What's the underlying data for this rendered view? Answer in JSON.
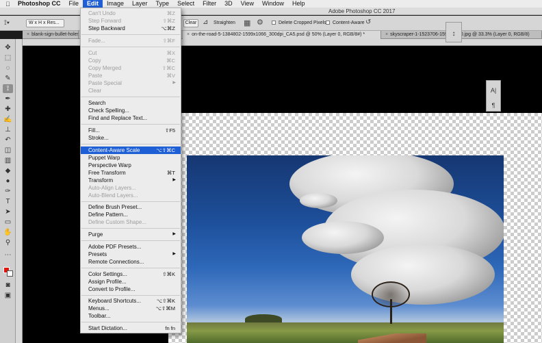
{
  "menubar": {
    "apple_icon": "apple-icon",
    "items": [
      "Photoshop CC",
      "File",
      "Edit",
      "Image",
      "Layer",
      "Type",
      "Select",
      "Filter",
      "3D",
      "View",
      "Window",
      "Help"
    ],
    "active": "Edit"
  },
  "titlebar": {
    "title": "Adobe Photoshop CC 2017"
  },
  "options_bar": {
    "ratio": "W x H x Res...",
    "clear": "Clear",
    "straighten": "Straighten",
    "delete_cropped": "Delete Cropped Pixels",
    "content_aware": "Content-Aware"
  },
  "tabs": [
    {
      "label": "blank-sign-bullet-holes",
      "close": "×"
    },
    {
      "label": "on-the-road-5-1384802-1599x1066_300dpi_CA5.psd @ 50% (Layer 0, RGB/8#) *",
      "close": "×"
    },
    {
      "label": "skyscraper-1-1523706-1599x1200.jpg @ 33.3% (Layer 0, RGB/8)",
      "close": "×"
    }
  ],
  "tools": [
    "move-icon",
    "marquee-icon",
    "lasso-icon",
    "quick-select-icon",
    "crop-icon",
    "eyedropper-icon",
    "healing-icon",
    "brush-icon",
    "stamp-icon",
    "history-brush-icon",
    "eraser-icon",
    "gradient-icon",
    "blur-icon",
    "dodge-icon",
    "pen-icon",
    "type-icon",
    "path-select-icon",
    "shape-icon",
    "hand-icon",
    "zoom-icon",
    "more-icon"
  ],
  "colors": {
    "foreground": "#e0160f",
    "background": "#ffffff",
    "highlight": "#1f5fd6"
  },
  "edit_menu": [
    {
      "label": "Can't Undo",
      "shortcut": "⌘Z",
      "disabled": true
    },
    {
      "label": "Step Forward",
      "shortcut": "⇧⌘Z",
      "disabled": true
    },
    {
      "label": "Step Backward",
      "shortcut": "⌥⌘Z",
      "disabled": false
    },
    {
      "label": "Fade...",
      "shortcut": "⇧⌘F",
      "disabled": true
    },
    {
      "label": "Cut",
      "shortcut": "⌘X",
      "disabled": true
    },
    {
      "label": "Copy",
      "shortcut": "⌘C",
      "disabled": true
    },
    {
      "label": "Copy Merged",
      "shortcut": "⇧⌘C",
      "disabled": true
    },
    {
      "label": "Paste",
      "shortcut": "⌘V",
      "disabled": true
    },
    {
      "label": "Paste Special",
      "shortcut": "",
      "disabled": true,
      "submenu": true
    },
    {
      "label": "Clear",
      "shortcut": "",
      "disabled": true
    },
    {
      "label": "Search",
      "shortcut": "",
      "disabled": false
    },
    {
      "label": "Check Spelling...",
      "shortcut": "",
      "disabled": false
    },
    {
      "label": "Find and Replace Text...",
      "shortcut": "",
      "disabled": false
    },
    {
      "label": "Fill...",
      "shortcut": "⇧F5",
      "disabled": false
    },
    {
      "label": "Stroke...",
      "shortcut": "",
      "disabled": false
    },
    {
      "label": "Content-Aware Scale",
      "shortcut": "⌥⇧⌘C",
      "disabled": false,
      "highlighted": true
    },
    {
      "label": "Puppet Warp",
      "shortcut": "",
      "disabled": false
    },
    {
      "label": "Perspective Warp",
      "shortcut": "",
      "disabled": false
    },
    {
      "label": "Free Transform",
      "shortcut": "⌘T",
      "disabled": false
    },
    {
      "label": "Transform",
      "shortcut": "",
      "disabled": false,
      "submenu": true
    },
    {
      "label": "Auto-Align Layers...",
      "shortcut": "",
      "disabled": true
    },
    {
      "label": "Auto-Blend Layers...",
      "shortcut": "",
      "disabled": true
    },
    {
      "label": "Define Brush Preset...",
      "shortcut": "",
      "disabled": false
    },
    {
      "label": "Define Pattern...",
      "shortcut": "",
      "disabled": false
    },
    {
      "label": "Define Custom Shape...",
      "shortcut": "",
      "disabled": true
    },
    {
      "label": "Purge",
      "shortcut": "",
      "disabled": false,
      "submenu": true
    },
    {
      "label": "Adobe PDF Presets...",
      "shortcut": "",
      "disabled": false
    },
    {
      "label": "Presets",
      "shortcut": "",
      "disabled": false,
      "submenu": true
    },
    {
      "label": "Remote Connections...",
      "shortcut": "",
      "disabled": false
    },
    {
      "label": "Color Settings...",
      "shortcut": "⇧⌘K",
      "disabled": false
    },
    {
      "label": "Assign Profile...",
      "shortcut": "",
      "disabled": false
    },
    {
      "label": "Convert to Profile...",
      "shortcut": "",
      "disabled": false
    },
    {
      "label": "Keyboard Shortcuts...",
      "shortcut": "⌥⇧⌘K",
      "disabled": false
    },
    {
      "label": "Menus...",
      "shortcut": "⌥⇧⌘M",
      "disabled": false
    },
    {
      "label": "Toolbar...",
      "shortcut": "",
      "disabled": false
    },
    {
      "label": "Start Dictation...",
      "shortcut": "fn fn",
      "disabled": false
    }
  ],
  "side_panel": [
    "character-panel-icon",
    "paragraph-panel-icon"
  ]
}
